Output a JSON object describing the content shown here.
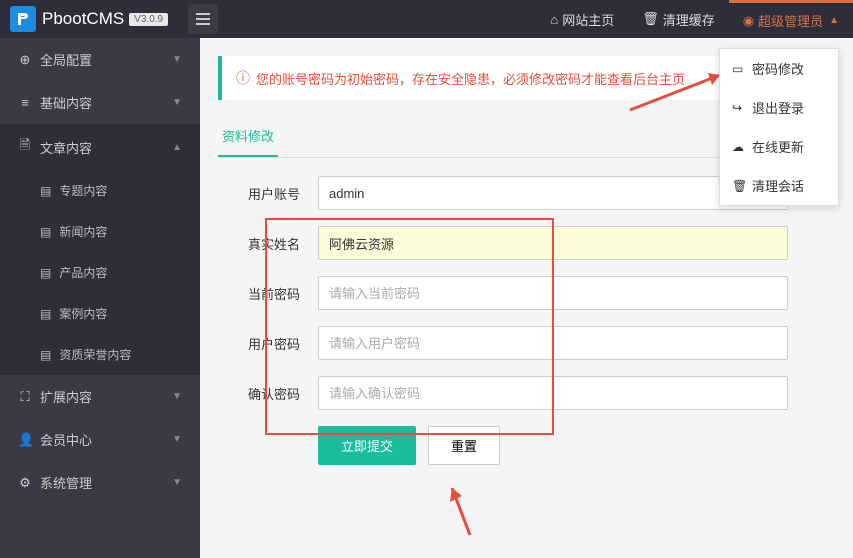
{
  "header": {
    "brand": "PbootCMS",
    "version": "V3.0.9",
    "home": "网站主页",
    "clear_cache": "清理缓存",
    "admin": "超级管理员"
  },
  "dropdown": {
    "password": "密码修改",
    "logout": "退出登录",
    "update": "在线更新",
    "sessions": "清理会话"
  },
  "sidebar": {
    "global": "全局配置",
    "basic": "基础内容",
    "article": "文章内容",
    "sub": {
      "topic": "专题内容",
      "news": "新闻内容",
      "product": "产品内容",
      "case": "案例内容",
      "honor": "资质荣誉内容"
    },
    "extend": "扩展内容",
    "member": "会员中心",
    "system": "系统管理"
  },
  "alert": "您的账号密码为初始密码，存在安全隐患，必须修改密码才能查看后台主页",
  "tab": "资料修改",
  "form": {
    "account_label": "用户账号",
    "account_value": "admin",
    "realname_label": "真实姓名",
    "realname_value": "阿佛云资源",
    "current_pwd_label": "当前密码",
    "current_pwd_placeholder": "请输入当前密码",
    "user_pwd_label": "用户密码",
    "user_pwd_placeholder": "请输入用户密码",
    "confirm_pwd_label": "确认密码",
    "confirm_pwd_placeholder": "请输入确认密码",
    "submit": "立即提交",
    "reset": "重置"
  }
}
